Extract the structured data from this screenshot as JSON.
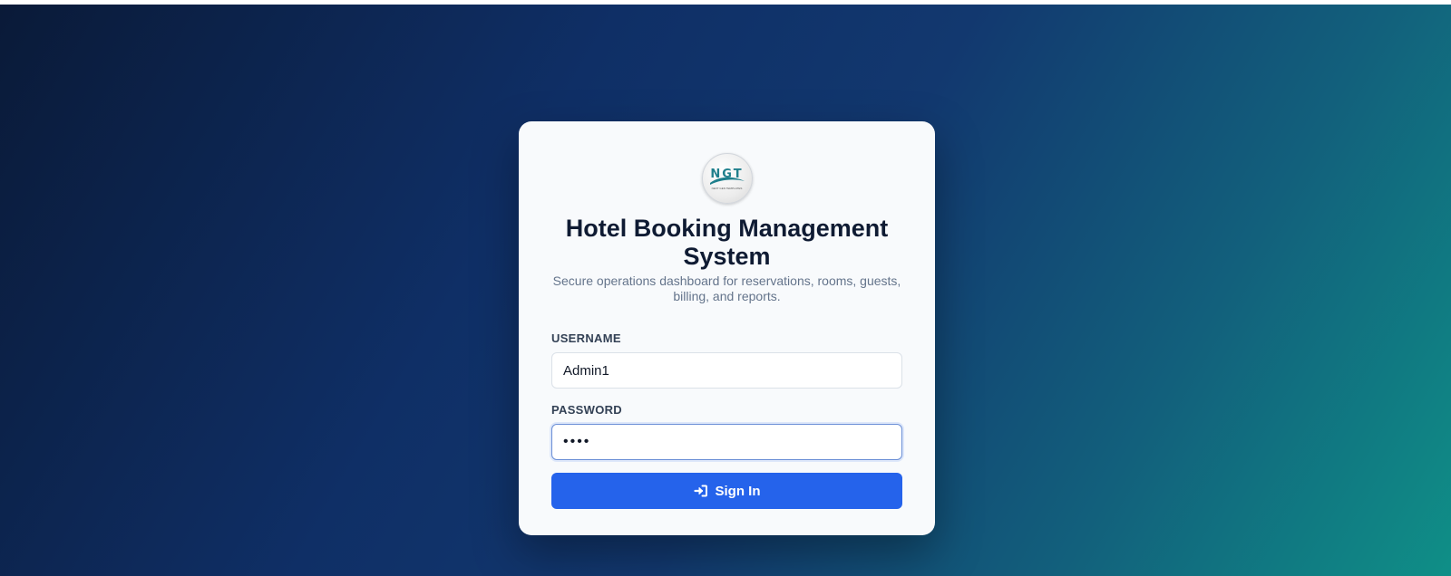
{
  "app": {
    "logo_text": "NGT",
    "logo_subtext": "NEXT GEN TEMPLATES",
    "title": "Hotel Booking Management System",
    "subtitle": "Secure operations dashboard for reservations, rooms, guests, billing, and reports."
  },
  "form": {
    "username_label": "USERNAME",
    "username_value": "Admin1",
    "password_label": "PASSWORD",
    "password_value": "1234",
    "submit_label": "Sign In",
    "submit_icon": "sign-in-icon"
  },
  "colors": {
    "primary": "#2563eb",
    "card_bg": "#f8fafc",
    "title_text": "#0f1b33",
    "logo_teal": "#1f7f8c"
  }
}
